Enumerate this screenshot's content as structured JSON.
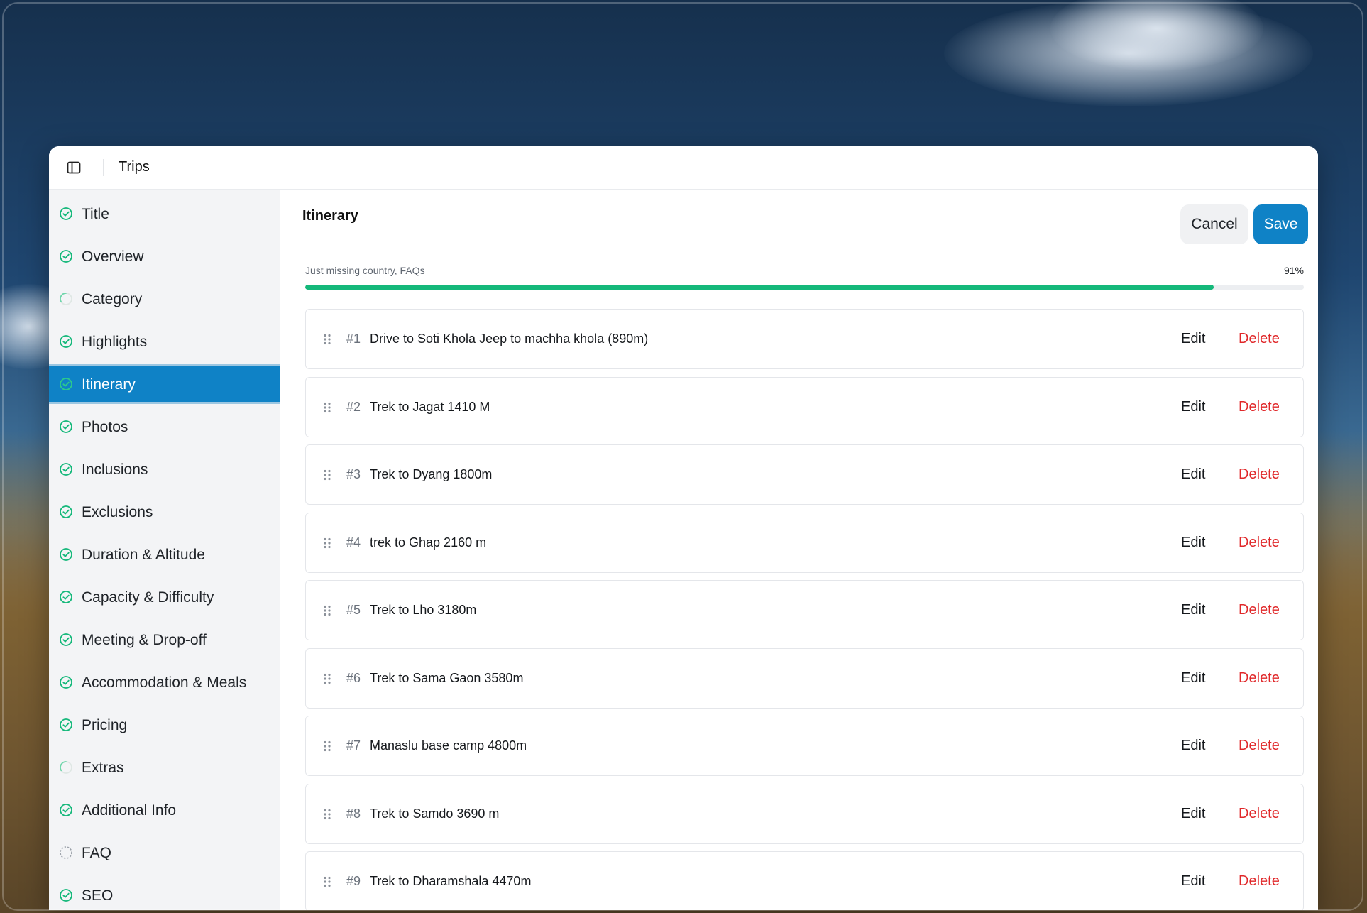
{
  "window": {
    "title": "Trips"
  },
  "icons": {
    "sidebar_toggle": "sidebar-toggle-icon",
    "done": "check-circle-icon",
    "partial": "partial-circle-icon",
    "empty": "dashed-circle-icon",
    "drag": "drag-handle-icon"
  },
  "colors": {
    "accent": "#0f82c6",
    "progress": "#14b87a",
    "delete": "#e0282a",
    "done_icon": "#14b87a",
    "partial_icon": "#6fd6ab",
    "empty_icon": "#9aa0a8"
  },
  "sidebar": {
    "items": [
      {
        "label": "Title",
        "status": "done"
      },
      {
        "label": "Overview",
        "status": "done"
      },
      {
        "label": "Category",
        "status": "partial"
      },
      {
        "label": "Highlights",
        "status": "done"
      },
      {
        "label": "Itinerary",
        "status": "done",
        "active": true
      },
      {
        "label": "Photos",
        "status": "done"
      },
      {
        "label": "Inclusions",
        "status": "done"
      },
      {
        "label": "Exclusions",
        "status": "done"
      },
      {
        "label": "Duration & Altitude",
        "status": "done"
      },
      {
        "label": "Capacity & Difficulty",
        "status": "done"
      },
      {
        "label": "Meeting & Drop-off",
        "status": "done"
      },
      {
        "label": "Accommodation & Meals",
        "status": "done"
      },
      {
        "label": "Pricing",
        "status": "done"
      },
      {
        "label": "Extras",
        "status": "partial"
      },
      {
        "label": "Additional Info",
        "status": "done"
      },
      {
        "label": "FAQ",
        "status": "empty"
      },
      {
        "label": "SEO",
        "status": "done"
      }
    ]
  },
  "main": {
    "title": "Itinerary",
    "cancel_label": "Cancel",
    "save_label": "Save",
    "progress": {
      "text": "Just missing country, FAQs",
      "percent_label": "91%",
      "value": 0.91
    },
    "edit_label": "Edit",
    "delete_label": "Delete",
    "rows": [
      {
        "num": "#1",
        "title": "Drive to Soti Khola Jeep to machha khola (890m)"
      },
      {
        "num": "#2",
        "title": "Trek to Jagat 1410 M"
      },
      {
        "num": "#3",
        "title": "Trek to Dyang 1800m"
      },
      {
        "num": "#4",
        "title": "trek to Ghap 2160 m"
      },
      {
        "num": "#5",
        "title": "Trek to Lho 3180m"
      },
      {
        "num": "#6",
        "title": "Trek to Sama Gaon 3580m"
      },
      {
        "num": "#7",
        "title": "Manaslu base camp 4800m"
      },
      {
        "num": "#8",
        "title": "Trek to Samdo 3690 m"
      },
      {
        "num": "#9",
        "title": " Trek to Dharamshala 4470m"
      }
    ]
  }
}
